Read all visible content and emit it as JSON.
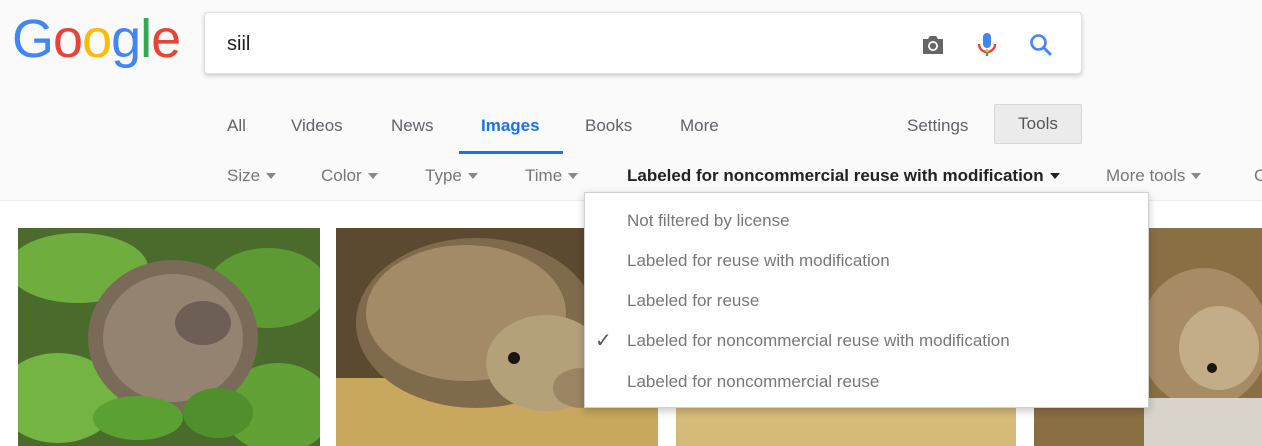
{
  "logo": {
    "letters": [
      "G",
      "o",
      "o",
      "g",
      "l",
      "e"
    ],
    "colors": [
      "#4285F4",
      "#EA4335",
      "#FBBC05",
      "#4285F4",
      "#34A853",
      "#EA4335"
    ]
  },
  "search": {
    "query": "siil"
  },
  "icons": {
    "camera": "camera-icon",
    "mic": "microphone-icon",
    "search": "search-icon"
  },
  "tabs": [
    {
      "label": "All"
    },
    {
      "label": "Videos"
    },
    {
      "label": "News"
    },
    {
      "label": "Images",
      "active": true
    },
    {
      "label": "Books"
    },
    {
      "label": "More"
    }
  ],
  "settings_label": "Settings",
  "tools_label": "Tools",
  "filters": {
    "size": "Size",
    "color": "Color",
    "type": "Type",
    "time": "Time",
    "license": "Labeled for noncommercial reuse with modification",
    "more_tools": "More tools",
    "clear": "C"
  },
  "license_menu": {
    "items": [
      "Not filtered by license",
      "Labeled for reuse with modification",
      "Labeled for reuse",
      "Labeled for noncommercial reuse with modification",
      "Labeled for noncommercial reuse"
    ],
    "selected_index": 3,
    "check": "✓"
  },
  "accent": "#1a73e8"
}
